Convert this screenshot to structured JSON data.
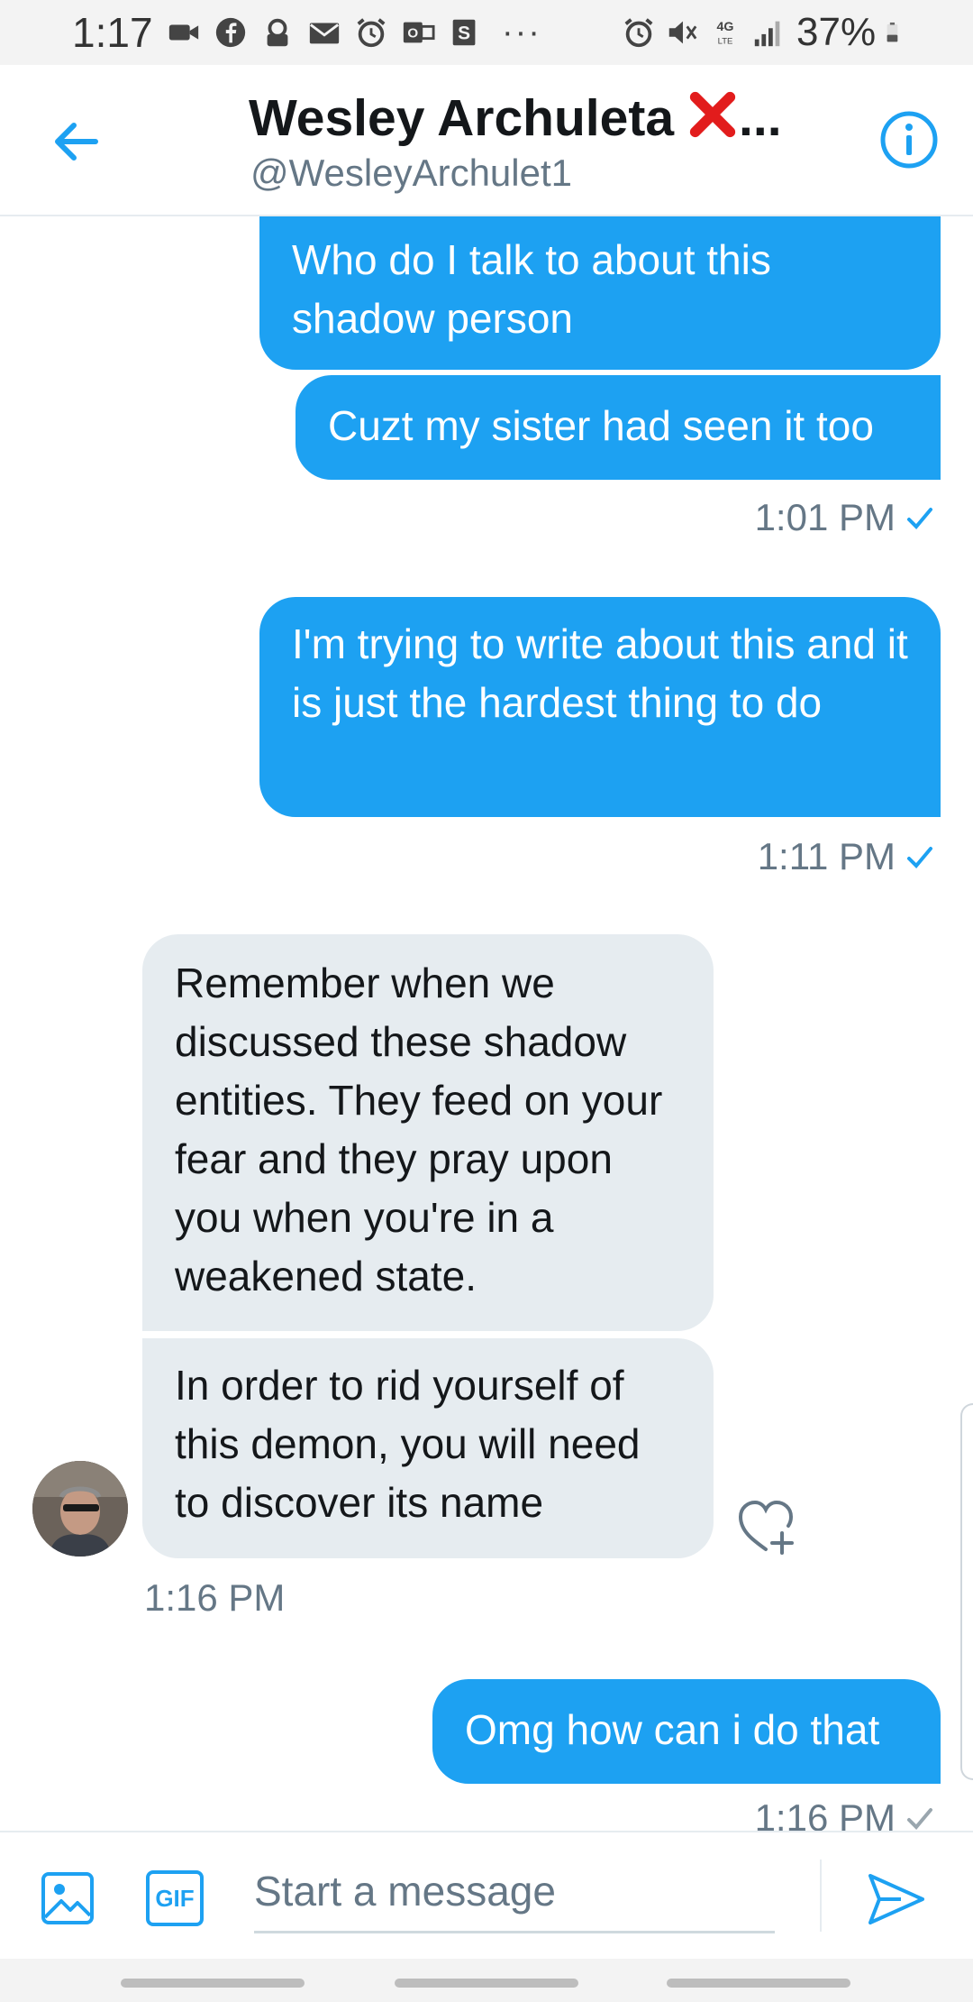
{
  "status_bar": {
    "time": "1:17",
    "battery": "37%",
    "icons_left": [
      "video-icon",
      "facebook-icon",
      "lock-icon",
      "mail-icon",
      "alarm-icon",
      "outlook-icon",
      "s-app-icon"
    ],
    "overflow": "···",
    "icons_right": [
      "alarm-icon",
      "mute-icon",
      "4g-lte-icon",
      "signal-icon",
      "battery-icon"
    ]
  },
  "header": {
    "name": "Wesley Archuleta",
    "name_suffix": "...",
    "handle": "@WesleyArchulet1"
  },
  "messages": [
    {
      "direction": "out",
      "text": "Who do I talk to about this shadow person"
    },
    {
      "direction": "out",
      "text": "Cuzt my sister had seen it too"
    },
    {
      "direction": "out",
      "timestamp": "1:01 PM"
    },
    {
      "direction": "out",
      "text": "I'm trying to write about this and it is just the hardest thing to do"
    },
    {
      "direction": "out",
      "timestamp": "1:11 PM"
    },
    {
      "direction": "in",
      "text": "Remember when we discussed these shadow entities. They feed on your fear and they pray upon you when you're in a weakened state."
    },
    {
      "direction": "in",
      "text": "In order to rid yourself of this demon, you will need to discover its name"
    },
    {
      "direction": "in",
      "timestamp": "1:16 PM"
    },
    {
      "direction": "out",
      "text": "Omg how can i do that"
    },
    {
      "direction": "out",
      "timestamp": "1:16 PM"
    }
  ],
  "composer": {
    "placeholder": "Start a message",
    "gif_label": "GIF"
  },
  "colors": {
    "accent": "#1da1f2",
    "incoming_bubble": "#e6ecf0",
    "secondary_text": "#657786"
  }
}
